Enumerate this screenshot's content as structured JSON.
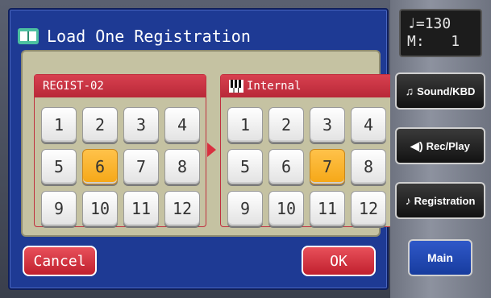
{
  "dialog": {
    "title": "Load One Registration",
    "icon": "book-icon"
  },
  "source_group": {
    "label": "REGIST-02",
    "buttons": [
      "1",
      "2",
      "3",
      "4",
      "5",
      "6",
      "7",
      "8",
      "9",
      "10",
      "11",
      "12"
    ],
    "selected": "6"
  },
  "dest_group": {
    "label": "Internal",
    "icon": "piano-icon",
    "buttons": [
      "1",
      "2",
      "3",
      "4",
      "5",
      "6",
      "7",
      "8",
      "9",
      "10",
      "11",
      "12"
    ],
    "selected": "7"
  },
  "actions": {
    "cancel_label": "Cancel",
    "ok_label": "OK"
  },
  "side_panel": {
    "tempo_symbol": "♩=",
    "tempo_value": "130",
    "measure_label": "M:",
    "measure_value": "1",
    "buttons": [
      {
        "label": "Sound/KBD",
        "icon": "notes-icon"
      },
      {
        "label": "Rec/Play",
        "icon": "speaker-icon"
      },
      {
        "label": "Registration",
        "icon": "music-book-icon"
      }
    ],
    "main_label": "Main"
  },
  "colors": {
    "dialog_bg": "#1e3a94",
    "panel_bg": "#c5c2a2",
    "header_red": "#c8303f",
    "selected_orange": "#f5a716"
  }
}
